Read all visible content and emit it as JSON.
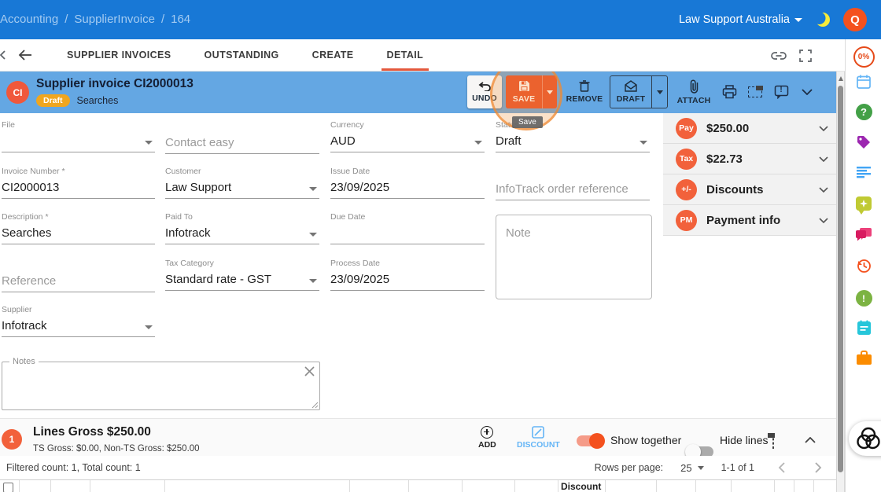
{
  "topbar": {
    "breadcrumb": {
      "items": [
        "Accounting",
        "SupplierInvoice",
        "164"
      ],
      "separator": "/"
    },
    "company": "Law Support Australia",
    "avatar": "Q"
  },
  "tabs": {
    "supplier_invoices": "SUPPLIER INVOICES",
    "outstanding": "OUTSTANDING",
    "create": "CREATE",
    "detail": "DETAIL"
  },
  "header": {
    "avatar": "CI",
    "title": "Supplier invoice CI2000013",
    "status_badge": "Draft",
    "subtitle": "Searches",
    "toolbar": {
      "undo": "UNDO",
      "save": "SAVE",
      "remove": "REMOVE",
      "draft": "DRAFT",
      "attach": "ATTACH"
    },
    "save_tooltip": "Save"
  },
  "form": {
    "file": {
      "label": "File"
    },
    "contact": {
      "placeholder": "Contact easy"
    },
    "currency": {
      "label": "Currency",
      "value": "AUD"
    },
    "status": {
      "label": "Status",
      "value": "Draft"
    },
    "invoice_number": {
      "label": "Invoice Number *",
      "value": "CI2000013"
    },
    "customer": {
      "label": "Customer",
      "value": "Law Support"
    },
    "issue_date": {
      "label": "Issue Date",
      "value": "23/09/2025"
    },
    "infotrack_reference": {
      "placeholder": "InfoTrack order reference"
    },
    "description": {
      "label": "Description *",
      "value": "Searches"
    },
    "paid_to": {
      "label": "Paid To",
      "value": "Infotrack"
    },
    "due_date": {
      "label": "Due Date"
    },
    "note": {
      "placeholder": "Note"
    },
    "reference": {
      "placeholder": "Reference"
    },
    "tax_category": {
      "label": "Tax Category",
      "value": "Standard rate - GST"
    },
    "process_date": {
      "label": "Process Date",
      "value": "23/09/2025"
    },
    "supplier": {
      "label": "Supplier",
      "value": "Infotrack"
    },
    "notes": {
      "label": "Notes"
    }
  },
  "summary": {
    "rows": [
      {
        "badge": "Pay",
        "text": "$250.00"
      },
      {
        "badge": "Tax",
        "text": "$22.73"
      },
      {
        "badge": "+/-",
        "text": "Discounts"
      },
      {
        "badge": "PM",
        "text": "Payment info"
      }
    ]
  },
  "rail": {
    "progress": "0%"
  },
  "glyphs": {
    "question": "?",
    "exclamation": "!"
  },
  "lines_bar": {
    "row_badge": "1",
    "title": "Lines Gross $250.00",
    "subtitle": "TS Gross: $0.00, Non-TS Gross: $250.00",
    "add": "ADD",
    "discount": "DISCOUNT",
    "show_together": "Show together",
    "hide_lines": "Hide lines"
  },
  "footer": {
    "filtered": "Filtered count: 1, Total count: 1",
    "rows_per_page_label": "Rows per page:",
    "rows_per_page_value": "25",
    "range": "1-1 of 1"
  },
  "lines_table": {
    "discount_header": "Discount"
  },
  "colors": {
    "topbar_blue": "#1878D6",
    "header_blue": "#64A7E3",
    "accent_orange": "#F4511E",
    "save_red": "#E94A22",
    "draft_badge_amber": "#F0A61F",
    "tab_underline_red": "#E4583C",
    "discount_blue": "#64B5F6"
  }
}
